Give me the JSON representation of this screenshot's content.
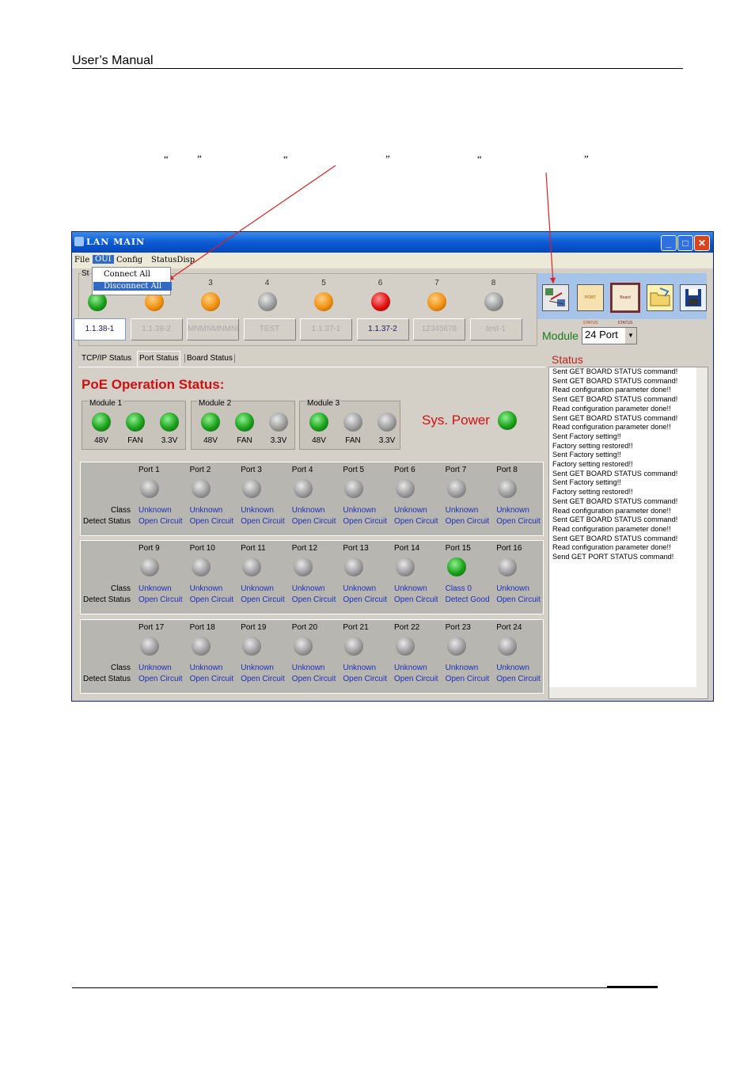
{
  "doc": {
    "header": "User’s  Manual",
    "quotes": [
      "“",
      "”",
      "“",
      "”",
      "“",
      "”"
    ]
  },
  "window": {
    "title": "LAN MAIN",
    "menu": [
      "File",
      "OUI",
      "Config",
      "StatusDisp"
    ],
    "dropdown": [
      "Connect All",
      "Disconnect All"
    ],
    "group_label": "St",
    "modules": [
      {
        "num": "",
        "ip": "1.1.38-1",
        "status": "green",
        "active": true
      },
      {
        "num": "",
        "ip": "1.1.38-2",
        "status": "orange",
        "active": false
      },
      {
        "num": "3",
        "ip": "MNMNMNMNMN",
        "status": "orange",
        "active": false
      },
      {
        "num": "4",
        "ip": "TEST",
        "status": "gray",
        "active": false
      },
      {
        "num": "5",
        "ip": "1.1.37-1",
        "status": "orange",
        "active": false
      },
      {
        "num": "6",
        "ip": "1.1.37-2",
        "status": "red",
        "active": true
      },
      {
        "num": "7",
        "ip": "12345678",
        "status": "orange",
        "active": false
      },
      {
        "num": "8",
        "ip": "test-1",
        "status": "gray",
        "active": false
      }
    ],
    "toolbar_icons": [
      "connect-icon",
      "port-status-icon",
      "board-status-icon",
      "open-folder-icon",
      "save-icon"
    ],
    "toolbar_text": {
      "port_status": "PORT STATUS",
      "board_status": "Board STATUS"
    },
    "module_label": "Module",
    "module_select": "24 Port",
    "status_label": "Status",
    "status_log": [
      "Sent GET BOARD STATUS command!",
      "Sent GET BOARD STATUS command!",
      "Read configuration parameter done!!",
      "Sent GET BOARD STATUS command!",
      "Read configuration parameter done!!",
      "Sent GET BOARD STATUS command!",
      "Read configuration parameter done!!",
      "Sent Factory setting!!",
      "Factory setting restored!!",
      "Sent Factory setting!!",
      "Factory setting restored!!",
      "Sent GET BOARD STATUS command!",
      "Sent Factory setting!!",
      "Factory setting restored!!",
      "Sent GET BOARD STATUS command!",
      "Read configuration parameter done!!",
      "Sent GET BOARD STATUS command!",
      "Read configuration parameter done!!",
      "Sent GET BOARD STATUS command!",
      "Read configuration parameter done!!",
      "Send GET PORT STATUS command!"
    ],
    "tabs": [
      "TCP/IP Status",
      "Port Status",
      "Board Status"
    ],
    "poe_title": "PoE Operation Status:",
    "power_modules": [
      {
        "label": "Module 1",
        "leds": [
          {
            "name": "48V",
            "status": "green"
          },
          {
            "name": "FAN",
            "status": "green"
          },
          {
            "name": "3.3V",
            "status": "green"
          }
        ]
      },
      {
        "label": "Module 2",
        "leds": [
          {
            "name": "48V",
            "status": "green"
          },
          {
            "name": "FAN",
            "status": "green"
          },
          {
            "name": "3.3V",
            "status": "gray"
          }
        ]
      },
      {
        "label": "Module 3",
        "leds": [
          {
            "name": "48V",
            "status": "green"
          },
          {
            "name": "FAN",
            "status": "gray"
          },
          {
            "name": "3.3V",
            "status": "gray"
          }
        ]
      }
    ],
    "sys_power": {
      "label": "Sys. Power",
      "status": "green"
    },
    "row_labels": {
      "class": "Class",
      "detect": "Detect Status"
    },
    "ports": [
      {
        "name": "Port 1",
        "status": "gray",
        "class": "Unknown",
        "detect": "Open Circuit"
      },
      {
        "name": "Port 2",
        "status": "gray",
        "class": "Unknown",
        "detect": "Open Circuit"
      },
      {
        "name": "Port 3",
        "status": "gray",
        "class": "Unknown",
        "detect": "Open Circuit"
      },
      {
        "name": "Port 4",
        "status": "gray",
        "class": "Unknown",
        "detect": "Open Circuit"
      },
      {
        "name": "Port 5",
        "status": "gray",
        "class": "Unknown",
        "detect": "Open Circuit"
      },
      {
        "name": "Port 6",
        "status": "gray",
        "class": "Unknown",
        "detect": "Open Circuit"
      },
      {
        "name": "Port 7",
        "status": "gray",
        "class": "Unknown",
        "detect": "Open Circuit"
      },
      {
        "name": "Port 8",
        "status": "gray",
        "class": "Unknown",
        "detect": "Open Circuit"
      },
      {
        "name": "Port 9",
        "status": "gray",
        "class": "Unknown",
        "detect": "Open Circuit"
      },
      {
        "name": "Port 10",
        "status": "gray",
        "class": "Unknown",
        "detect": "Open Circuit"
      },
      {
        "name": "Port 11",
        "status": "gray",
        "class": "Unknown",
        "detect": "Open Circuit"
      },
      {
        "name": "Port 12",
        "status": "gray",
        "class": "Unknown",
        "detect": "Open Circuit"
      },
      {
        "name": "Port 13",
        "status": "gray",
        "class": "Unknown",
        "detect": "Open Circuit"
      },
      {
        "name": "Port 14",
        "status": "gray",
        "class": "Unknown",
        "detect": "Open Circuit"
      },
      {
        "name": "Port 15",
        "status": "green",
        "class": "Class 0",
        "detect": "Detect Good"
      },
      {
        "name": "Port 16",
        "status": "gray",
        "class": "Unknown",
        "detect": "Open Circuit"
      },
      {
        "name": "Port 17",
        "status": "gray",
        "class": "Unknown",
        "detect": "Open Circuit"
      },
      {
        "name": "Port 18",
        "status": "gray",
        "class": "Unknown",
        "detect": "Open Circuit"
      },
      {
        "name": "Port 19",
        "status": "gray",
        "class": "Unknown",
        "detect": "Open Circuit"
      },
      {
        "name": "Port 20",
        "status": "gray",
        "class": "Unknown",
        "detect": "Open Circuit"
      },
      {
        "name": "Port 21",
        "status": "gray",
        "class": "Unknown",
        "detect": "Open Circuit"
      },
      {
        "name": "Port 22",
        "status": "gray",
        "class": "Unknown",
        "detect": "Open Circuit"
      },
      {
        "name": "Port 23",
        "status": "gray",
        "class": "Unknown",
        "detect": "Open Circuit"
      },
      {
        "name": "Port 24",
        "status": "gray",
        "class": "Unknown",
        "detect": "Open Circuit"
      }
    ]
  },
  "colors": {
    "green": "#1aa01a",
    "orange": "#f09010",
    "gray": "#9a9a9a",
    "red": "#e01010",
    "annotation": "#e02020"
  }
}
